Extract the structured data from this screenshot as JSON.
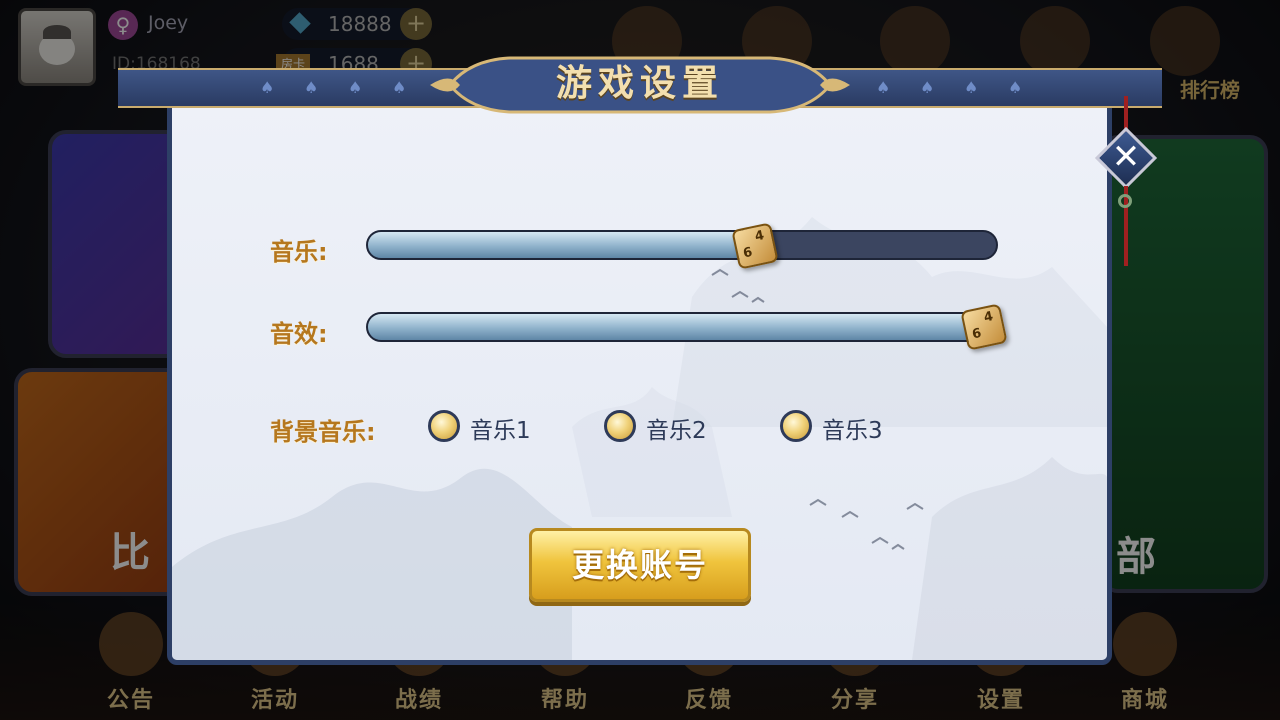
{
  "background": {
    "player": {
      "name": "Joey",
      "id": "ID:168168"
    },
    "resources": [
      {
        "type": "diamond",
        "value": "18888"
      },
      {
        "type": "room-card",
        "tag": "房卡",
        "value": "1688"
      }
    ],
    "top_right_label": "排行榜",
    "left_panel_label": "比",
    "right_panel_label": "部",
    "bottom_nav": [
      "公告",
      "活动",
      "战绩",
      "帮助",
      "反馈",
      "分享",
      "设置",
      "商城"
    ]
  },
  "dialog": {
    "title": "游戏设置",
    "close_icon": "close-icon",
    "sliders": [
      {
        "key": "music",
        "label": "音乐:",
        "value_fraction": 0.615
      },
      {
        "key": "sfx",
        "label": "音效:",
        "value_fraction": 1.0
      }
    ],
    "bg_music": {
      "label": "背景音乐:",
      "options": [
        "音乐1",
        "音乐2",
        "音乐3"
      ]
    },
    "switch_account_label": "更换账号"
  }
}
